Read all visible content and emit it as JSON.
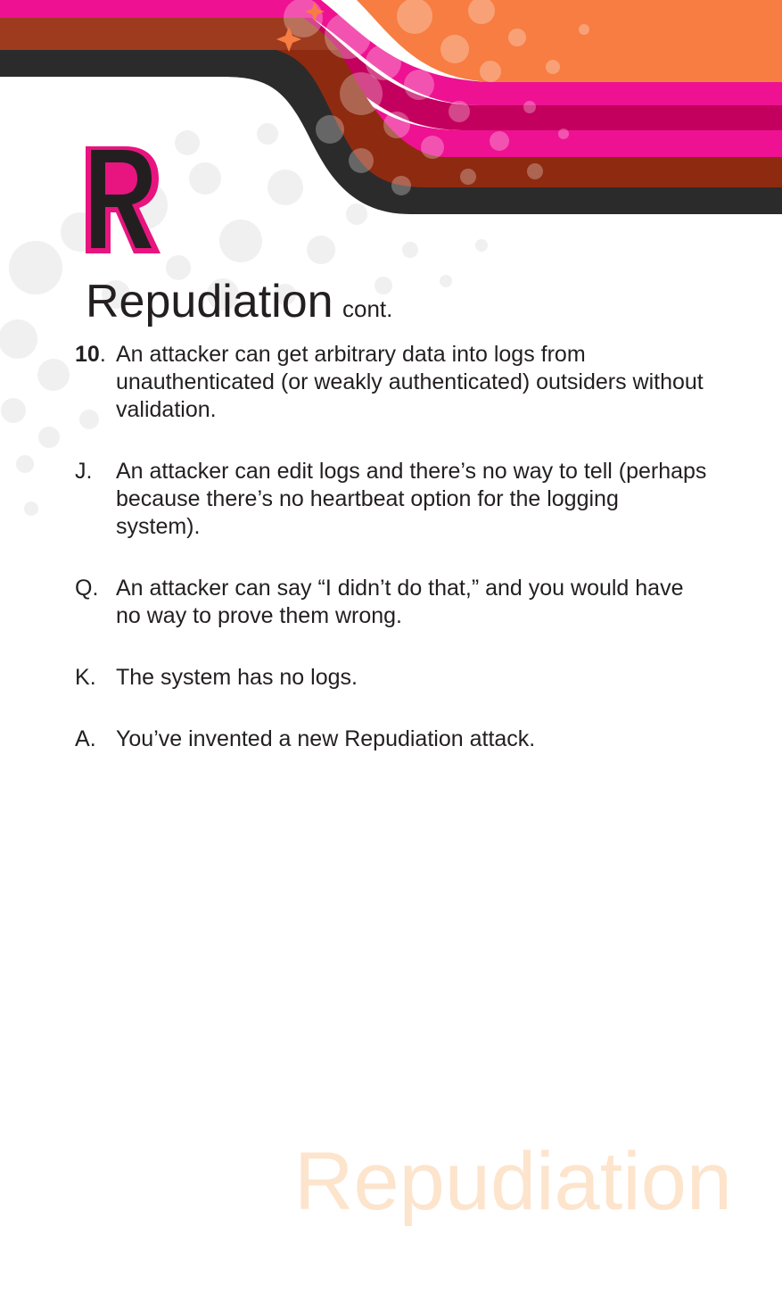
{
  "card": {
    "suit_letter": "R",
    "title": "Repudiation",
    "title_suffix": "cont.",
    "watermark": "Repudiation"
  },
  "threats": [
    {
      "rank": "10",
      "rank_bold": true,
      "text": "An attacker can get arbitrary data into logs from unauthenticated (or weakly authenticated) outsiders without validation."
    },
    {
      "rank": "J",
      "rank_bold": false,
      "text": "An attacker can edit logs and there’s no way to tell (perhaps because there’s no heartbeat option for the logging system)."
    },
    {
      "rank": "Q",
      "rank_bold": false,
      "text": "An attacker can say “I didn’t do that,” and you would have no way to prove them wrong."
    },
    {
      "rank": "K",
      "rank_bold": false,
      "text": "The system has no logs."
    },
    {
      "rank": "A",
      "rank_bold": false,
      "text": "You’ve invented a new Repudiation attack."
    }
  ],
  "colors": {
    "orange": "#f77d42",
    "pink": "#ee1192",
    "magenta_dark": "#c4005e",
    "rust": "#8e2a10",
    "charcoal": "#2b2b2b",
    "letter_outline": "#e8147f",
    "watermark": "#fde4cc"
  }
}
